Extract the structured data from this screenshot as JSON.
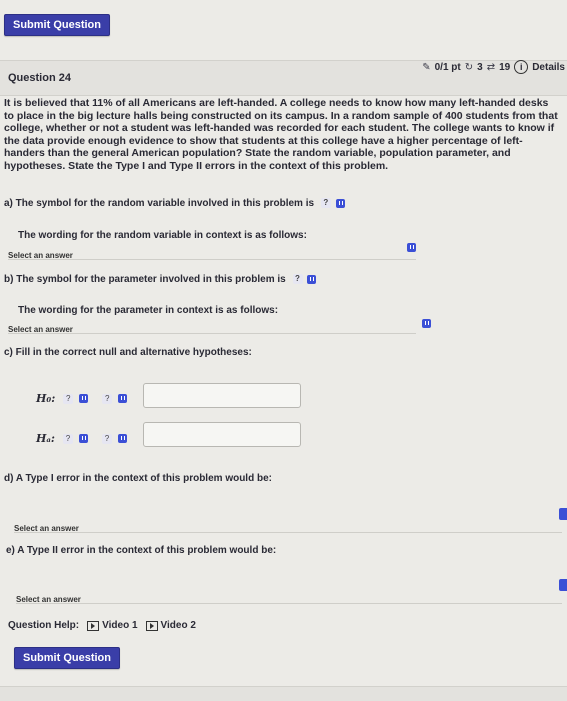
{
  "top_button": "Submit Question",
  "question": {
    "title": "Question 24",
    "score": "0/1 pt",
    "retries": "3",
    "attempts": "19",
    "details": "Details"
  },
  "problem_text": "It is believed that 11% of all Americans are left-handed. A college needs to know how many left-handed desks to place in the big lecture halls being constructed on its campus. In a random sample of 400 students from that college, whether or not a student was left-handed was recorded for each student. The college wants to know if the data provide enough evidence to show that students at this college have a higher percentage of left-handers than the general American population? State the random variable, population parameter, and hypotheses. State the Type I and Type II errors in the context of this problem.",
  "parts": {
    "a_label": "a) The symbol for the random variable involved in this problem is",
    "a_select": "?",
    "a_wording": "The wording for the random variable in context is as follows:",
    "a_answer": "Select an answer",
    "b_label": "b) The symbol for the parameter involved in this problem is",
    "b_select": "?",
    "b_wording": "The wording for the parameter in context is as follows:",
    "b_answer": "Select an answer",
    "c_label": "c) Fill in the correct null and alternative hypotheses:",
    "h0": "H₀:",
    "ha": "Hₐ:",
    "q_mark": "?",
    "d_label": "d) A Type I error in the context of this problem would be:",
    "d_answer": "Select an answer",
    "e_label": "e) A Type II error in the context of this problem would be:",
    "e_answer": "Select an answer"
  },
  "help": {
    "label": "Question Help:",
    "video1": "Video 1",
    "video2": "Video 2"
  },
  "bottom_button": "Submit Question",
  "colors": {
    "accent": "#3a3ea8",
    "select_icon": "#3b4fd6"
  }
}
